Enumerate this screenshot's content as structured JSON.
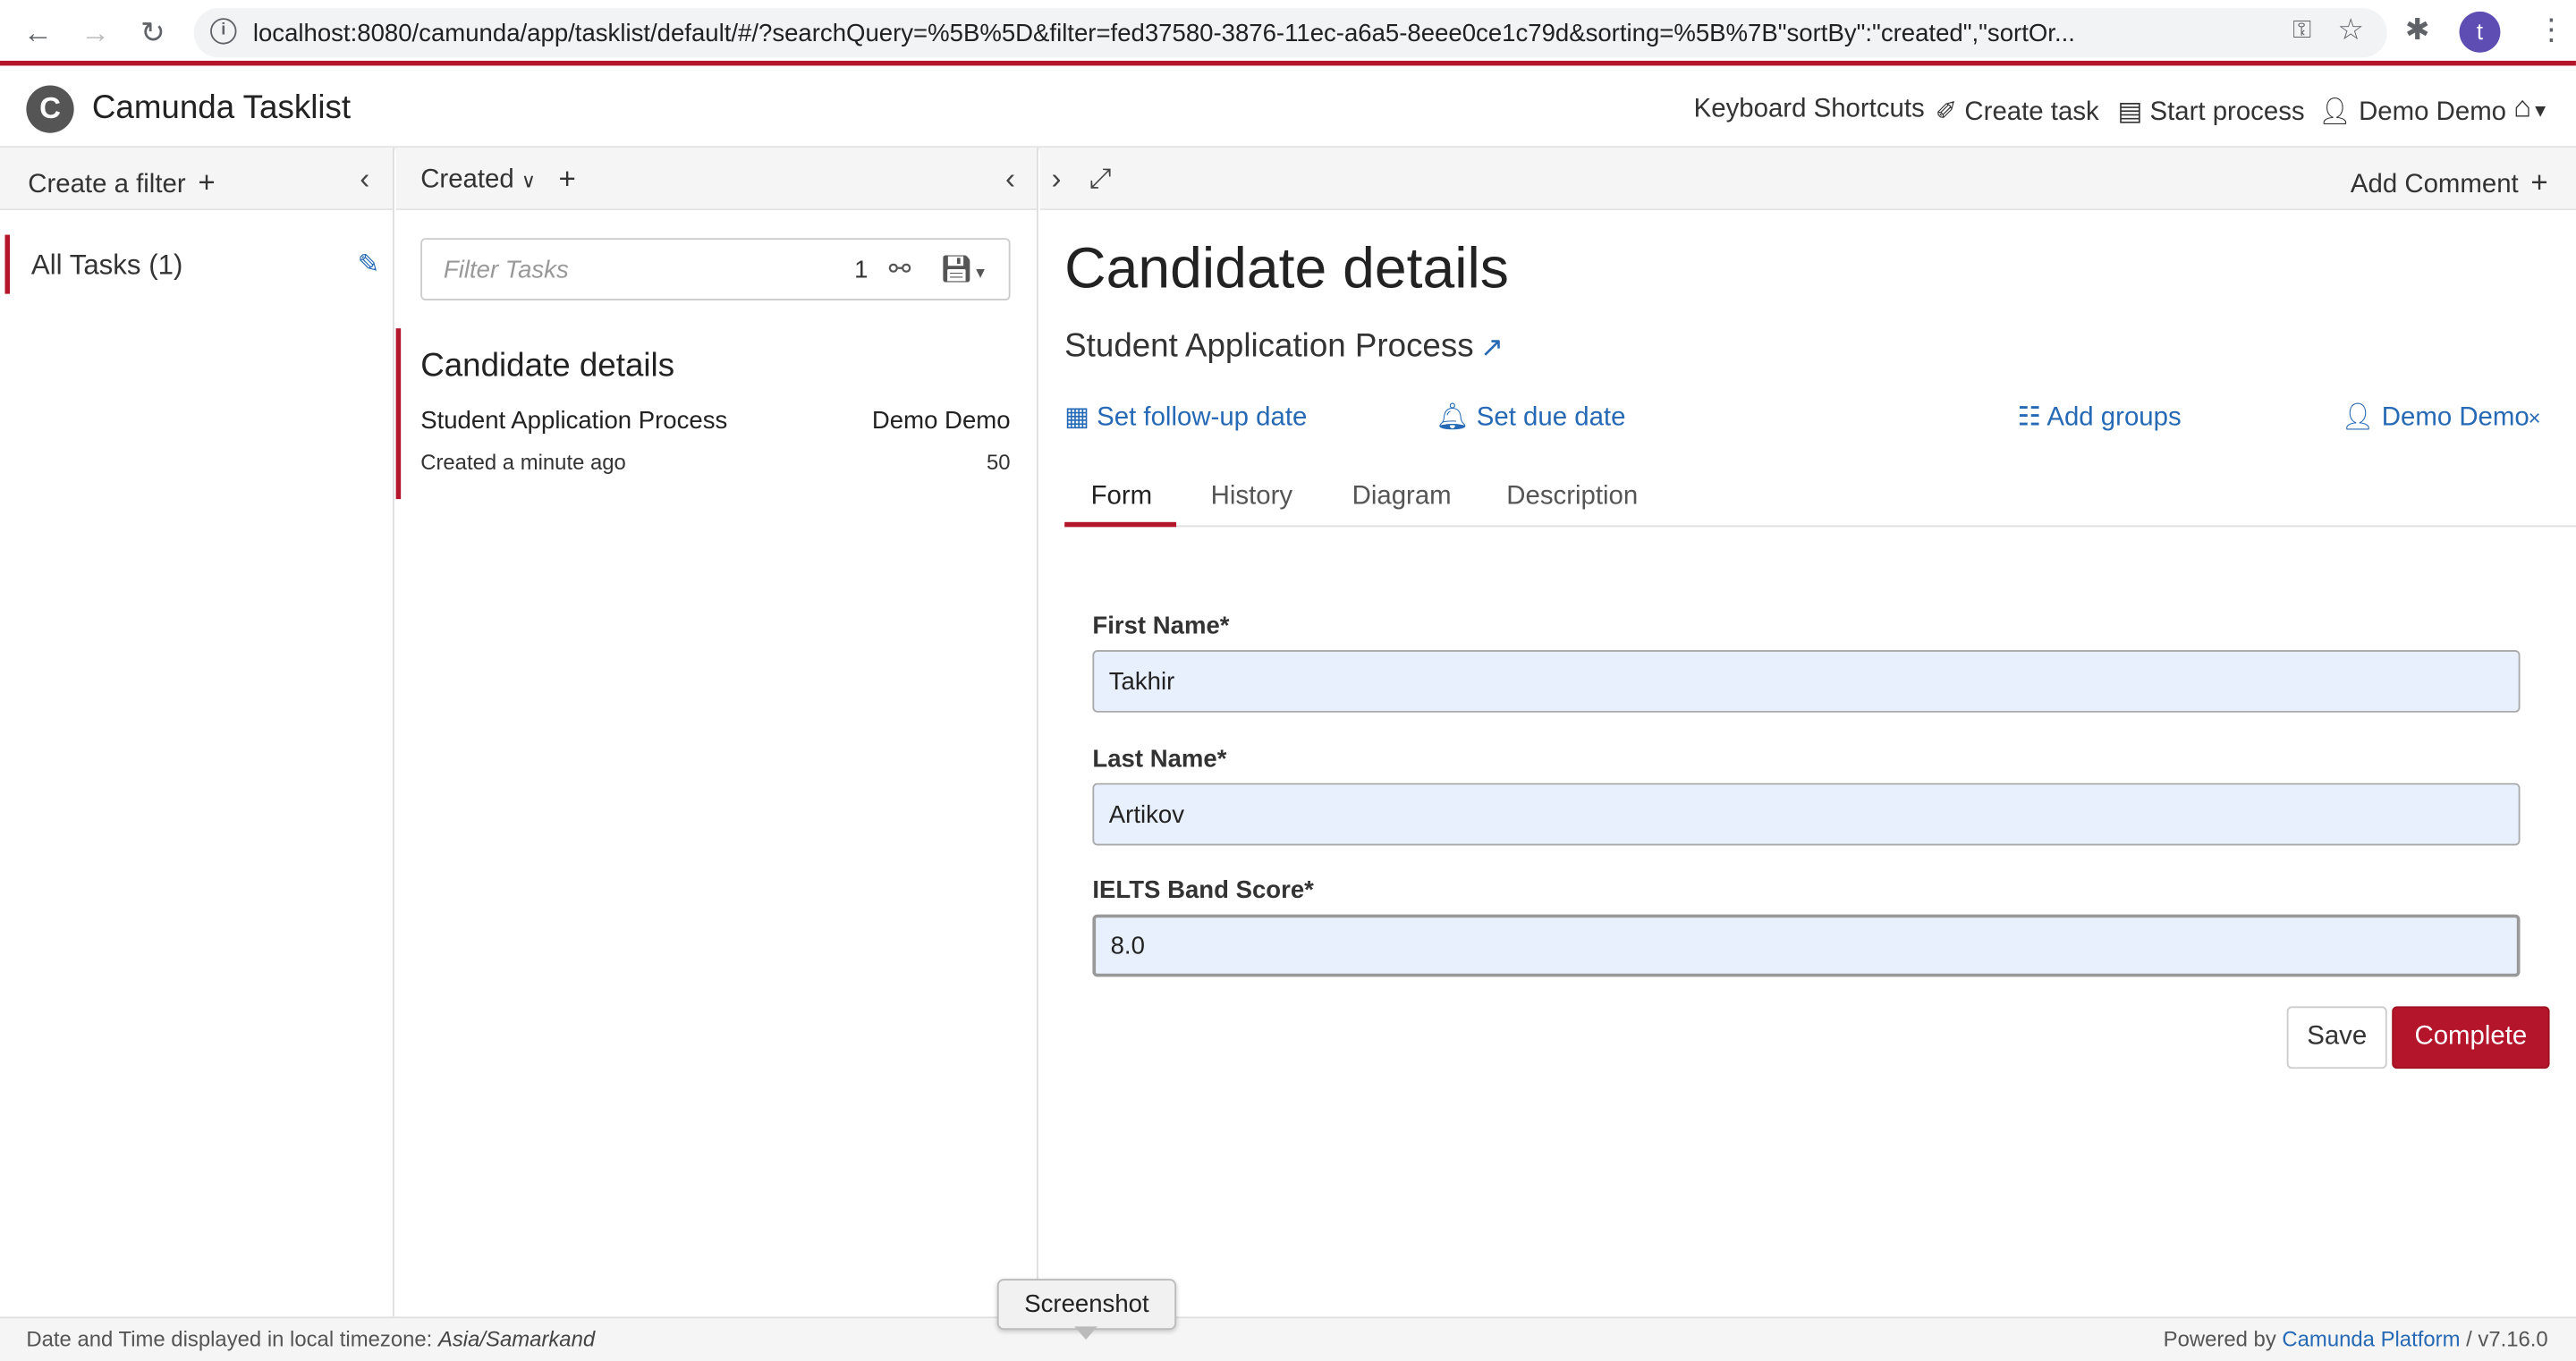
{
  "browser": {
    "url": "localhost:8080/camunda/app/tasklist/default/#/?searchQuery=%5B%5D&filter=fed37580-3876-11ec-a6a5-8eee0ce1c79d&sorting=%5B%7B\"sortBy\":\"created\",\"sortOr...",
    "profile_initial": "t"
  },
  "header": {
    "app_title": "Camunda Tasklist",
    "logo_letter": "C",
    "keyboard_shortcuts": "Keyboard Shortcuts",
    "create_task": "Create task",
    "start_process": "Start process",
    "user": "Demo Demo"
  },
  "filters": {
    "create_filter": "Create a filter",
    "items": [
      {
        "label": "All Tasks (1)"
      }
    ]
  },
  "list": {
    "sort_label": "Created",
    "search_placeholder": "Filter Tasks",
    "search_count": "1",
    "tasks": [
      {
        "name": "Candidate details",
        "process": "Student Application Process",
        "assignee": "Demo Demo",
        "created": "Created a minute ago",
        "priority": "50"
      }
    ]
  },
  "detail": {
    "add_comment": "Add Comment",
    "title": "Candidate details",
    "process": "Student Application Process",
    "follow_up": "Set follow-up date",
    "due_date": "Set due date",
    "add_groups": "Add groups",
    "assignee": "Demo Demo",
    "remove_assignee": "×",
    "tabs": [
      {
        "label": "Form"
      },
      {
        "label": "History"
      },
      {
        "label": "Diagram"
      },
      {
        "label": "Description"
      }
    ],
    "form": {
      "fields": [
        {
          "label": "First Name*",
          "value": "Takhir"
        },
        {
          "label": "Last Name*",
          "value": "Artikov"
        },
        {
          "label": "IELTS Band Score*",
          "value": "8.0"
        }
      ],
      "save": "Save",
      "complete": "Complete"
    }
  },
  "footer": {
    "tz_prefix": "Date and Time displayed in local timezone: ",
    "tz_value": "Asia/Samarkand",
    "powered_by": "Powered by ",
    "platform": "Camunda Platform",
    "version": " / v7.16.0"
  },
  "tooltip": {
    "text": "Screenshot"
  },
  "colors": {
    "accent": "#b5152b",
    "link": "#2669b5",
    "input_bg": "#e8f0fe",
    "panel_header": "#f5f5f5"
  }
}
